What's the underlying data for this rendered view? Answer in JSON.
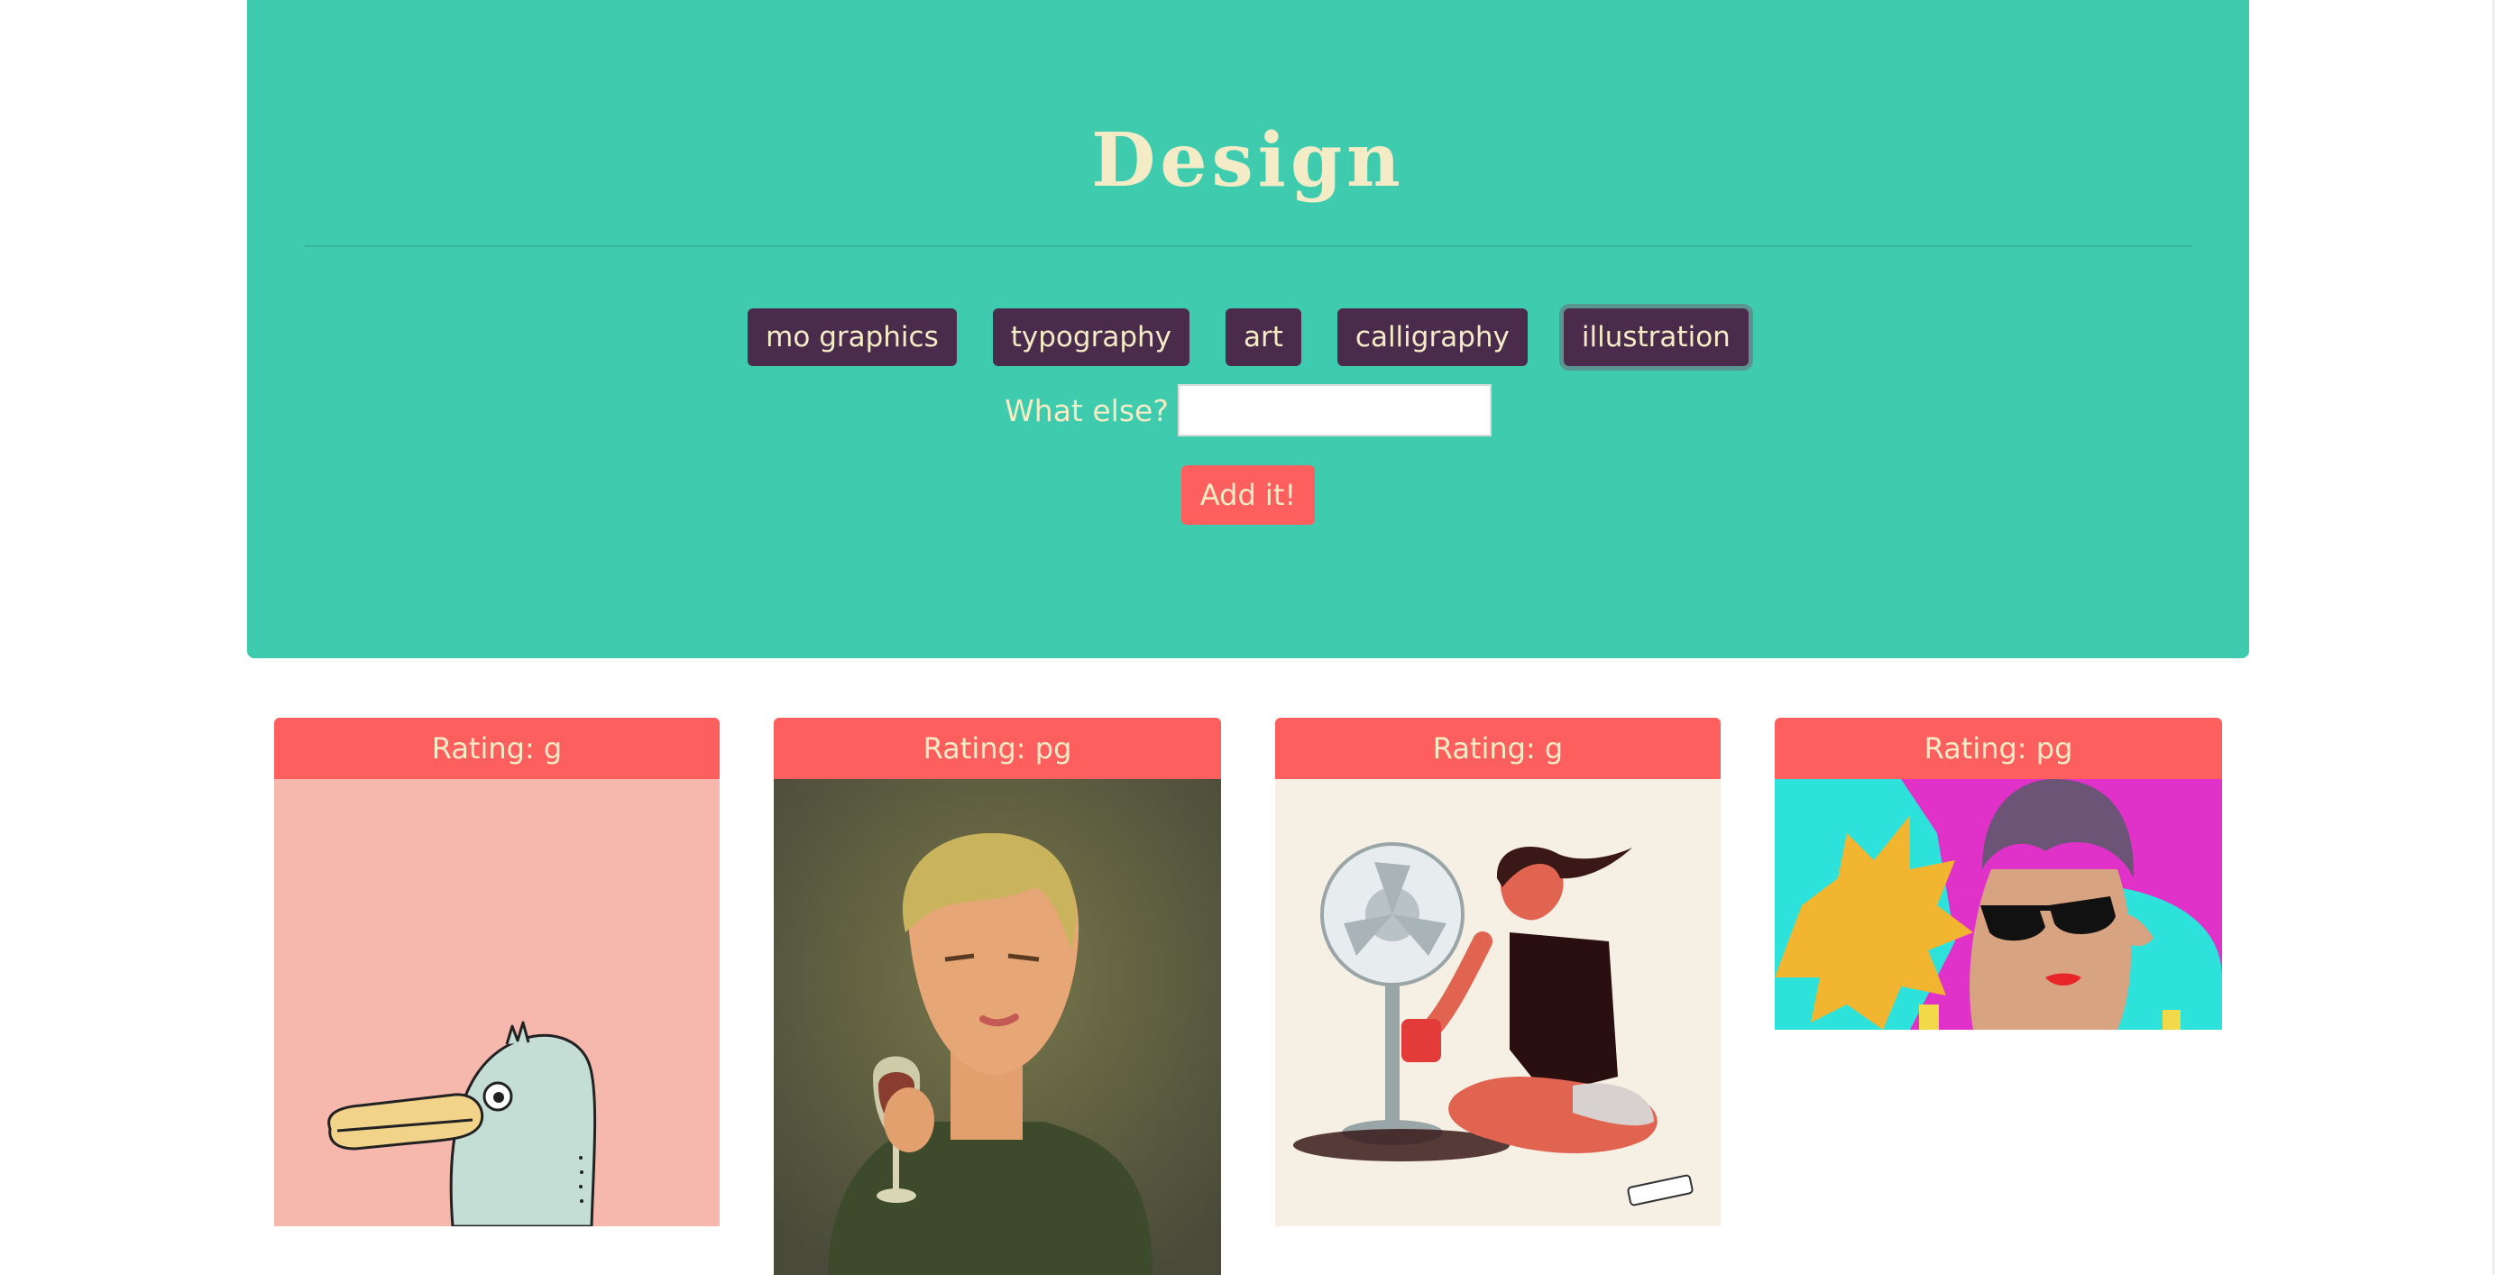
{
  "header": {
    "title": "Design",
    "topics": [
      "mo graphics",
      "typography",
      "art",
      "calligraphy",
      "illustration"
    ],
    "active_topic": "illustration"
  },
  "form": {
    "label": "What else?",
    "input_value": "",
    "button_label": "Add it!"
  },
  "gifs": [
    {
      "rating": "Rating: g",
      "image": "pink-background-cartoon-bird-illustration"
    },
    {
      "rating": "Rating: pg",
      "image": "woman-holding-wine-glass-illustration"
    },
    {
      "rating": "Rating: g",
      "image": "woman-sitting-by-electric-fan-illustration"
    },
    {
      "rating": "Rating: pg",
      "image": "woman-with-sunglasses-illustration"
    }
  ],
  "colors": {
    "jumbotron": "#3ecbae",
    "topic_button": "#4a2b4b",
    "accent": "#fd5e5e",
    "cream_text": "#f3ecc6"
  }
}
